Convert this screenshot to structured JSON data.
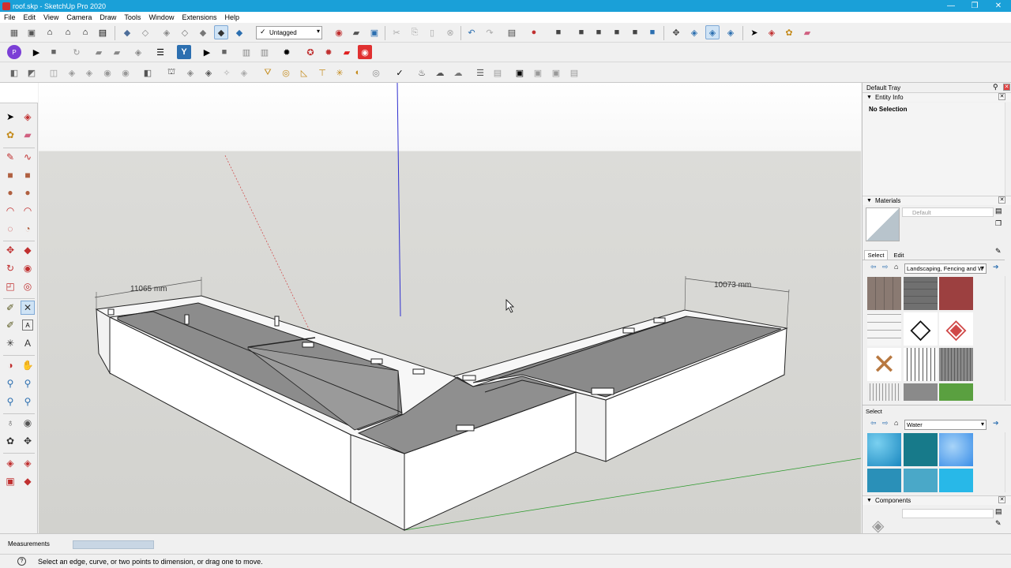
{
  "window": {
    "title": "roof.skp - SketchUp Pro 2020",
    "minimize": "—",
    "maximize": "❐",
    "close": "✕"
  },
  "menu": [
    "File",
    "Edit",
    "View",
    "Camera",
    "Draw",
    "Tools",
    "Window",
    "Extensions",
    "Help"
  ],
  "toolbar": {
    "tag_value": "Untagged",
    "tag_check": "✓"
  },
  "viewport": {
    "dimension_left": "11065 mm",
    "dimension_right": "10073 mm"
  },
  "tray": {
    "title": "Default Tray",
    "entity_info": {
      "title": "Entity Info",
      "selection": "No Selection"
    },
    "materials": {
      "title": "Materials",
      "current_name": "Default",
      "tab_select": "Select",
      "tab_edit": "Edit",
      "library": "Landscaping, Fencing and W",
      "secondary_label": "Select",
      "secondary_library": "Water"
    },
    "components": {
      "title": "Components"
    }
  },
  "measurements": {
    "label": "Measurements",
    "value": ""
  },
  "status": {
    "icon": "?",
    "text": "Select an edge, curve, or two points to dimension, or drag one to move."
  },
  "colors": {
    "titlebar": "#1aa0d8",
    "accent_blue": "#2c6fb0",
    "axis_blue": "#3030d0",
    "axis_green": "#2a9a2a",
    "axis_red": "#d04040"
  }
}
